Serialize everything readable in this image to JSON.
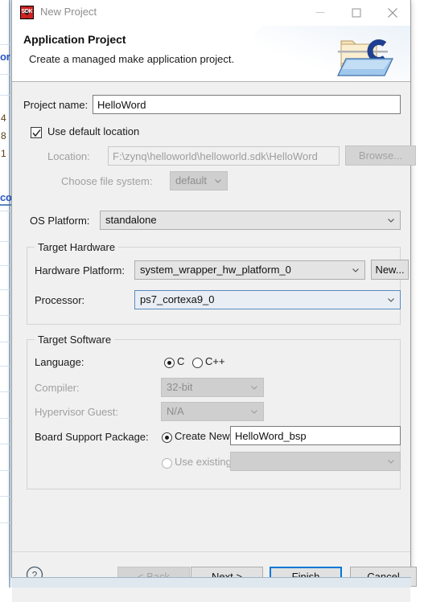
{
  "window": {
    "title": "New Project",
    "icon": "sdk-icon",
    "icon_text": "SDK",
    "minimize_label": "Minimize",
    "maximize_label": "Maximize",
    "close_label": "Close"
  },
  "header": {
    "title": "Application Project",
    "description": "Create a managed make application project.",
    "icon": "c-folder-icon",
    "icon_letter": "C"
  },
  "form": {
    "project_name_label": "Project name:",
    "project_name_value": "HelloWord",
    "use_default_location_label": "Use default location",
    "use_default_location_checked": true,
    "location_label": "Location:",
    "location_value": "F:\\zynq\\helloworld\\helloworld.sdk\\HelloWord",
    "browse_label": "Browse...",
    "choose_file_system_label": "Choose file system:",
    "choose_file_system_value": "default",
    "os_platform_label": "OS Platform:",
    "os_platform_value": "standalone"
  },
  "target_hardware": {
    "group_title": "Target Hardware",
    "hardware_platform_label": "Hardware Platform:",
    "hardware_platform_value": "system_wrapper_hw_platform_0",
    "new_button_label": "New...",
    "processor_label": "Processor:",
    "processor_value": "ps7_cortexa9_0"
  },
  "target_software": {
    "group_title": "Target Software",
    "language_label": "Language:",
    "language_options": [
      "C",
      "C++"
    ],
    "language_selected": "C",
    "compiler_label": "Compiler:",
    "compiler_value": "32-bit",
    "hypervisor_guest_label": "Hypervisor Guest:",
    "hypervisor_guest_value": "N/A",
    "bsp_label": "Board Support Package:",
    "bsp_create_new_label": "Create New",
    "bsp_create_new_value": "HelloWord_bsp",
    "bsp_use_existing_label": "Use existing",
    "bsp_use_existing_value": "",
    "bsp_selected": "Create New"
  },
  "footer": {
    "help_icon": "help-question-icon",
    "back_label": "< Back",
    "next_label": "Next >",
    "finish_label": "Finish",
    "cancel_label": "Cancel",
    "back_enabled": false,
    "default_button": "Finish"
  },
  "background": {
    "blue_fragment_1": "or",
    "blue_fragment_2": "co",
    "line_numbers": [
      "4",
      "8",
      "1"
    ]
  },
  "colors": {
    "accent": "#0078d7",
    "dialog_bg": "#f0f0f0",
    "title_text": "#8d8d8d",
    "field_border": "#7a7a7a",
    "disabled_text": "#a0a0a0"
  }
}
